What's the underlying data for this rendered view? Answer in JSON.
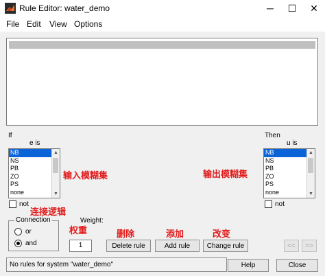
{
  "window": {
    "title": "Rule Editor: water_demo",
    "minimize_glyph": "─",
    "maximize_glyph": "☐",
    "close_glyph": "✕"
  },
  "menu": [
    "File",
    "Edit",
    "View",
    "Options"
  ],
  "input_panel": {
    "section_label": "If",
    "variable_label": "e is",
    "items": [
      "NB",
      "NS",
      "PB",
      "ZO",
      "PS",
      "none"
    ],
    "selected_item": "NB",
    "not_label": "not"
  },
  "output_panel": {
    "section_label": "Then",
    "variable_label": "u is",
    "items": [
      "NB",
      "NS",
      "PB",
      "ZO",
      "PS",
      "none"
    ],
    "selected_item": "NB",
    "not_label": "not"
  },
  "annotations": {
    "input_set": "输入模糊集",
    "output_set": "输出模糊集",
    "connection_logic": "连接逻辑",
    "weight": "权重",
    "delete": "删除",
    "add": "添加",
    "change": "改变"
  },
  "connection": {
    "title": "Connection",
    "options": [
      "or",
      "and"
    ],
    "selected": "and"
  },
  "weight": {
    "label": "Weight:",
    "value": "1"
  },
  "buttons": {
    "delete_rule": "Delete rule",
    "add_rule": "Add rule",
    "change_rule": "Change rule",
    "prev": "<<",
    "next": ">>",
    "help": "Help",
    "close": "Close"
  },
  "status": {
    "message": "No rules for system \"water_demo\""
  },
  "colors": {
    "selection": "#0a64d8",
    "annotation": "#e21b1b"
  }
}
